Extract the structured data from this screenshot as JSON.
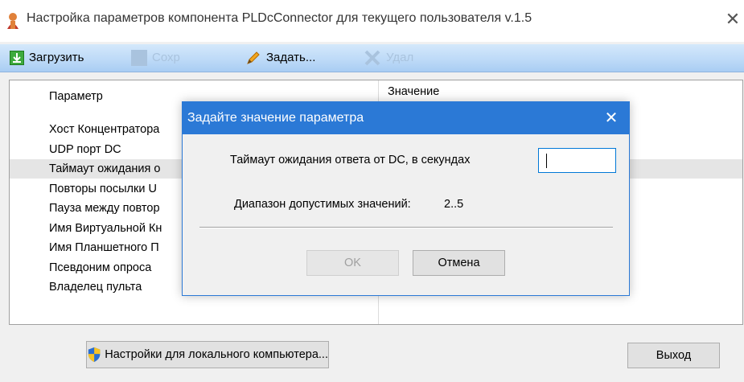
{
  "window": {
    "title": "Настройка параметров компонента PLDcConnector для текущего пользователя v.1.5",
    "close_glyph": "✕"
  },
  "toolbar": {
    "load_label": "Загрузить",
    "save_label": "Сохр",
    "set_label": "Задать...",
    "delete_label": "Удал"
  },
  "grid": {
    "col_param": "Параметр",
    "col_value": "Значение",
    "rows": [
      "Хост Концентратора",
      "UDP порт DC",
      "Таймаут ожидания о",
      "Повторы посылки U",
      "Пауза между повтор",
      "Имя Виртуальной Кн",
      "Имя Планшетного П",
      "Псевдоним опроса",
      "Владелец пульта"
    ],
    "selected_row": 2
  },
  "footer": {
    "local_settings_label": "Настройки для локального компьютера...",
    "exit_label": "Выход"
  },
  "dialog": {
    "title": "Задайте значение параметра",
    "close_glyph": "✕",
    "field_label": "Таймаут ожидания ответа от DC, в секундах",
    "field_value": "",
    "range_label": "Диапазон допустимых значений:",
    "range_value": "2..5",
    "ok_label": "OK",
    "cancel_label": "Отмена"
  },
  "colors": {
    "accent": "#2b79d6",
    "toolbar_bg": "#bcd9f7"
  }
}
